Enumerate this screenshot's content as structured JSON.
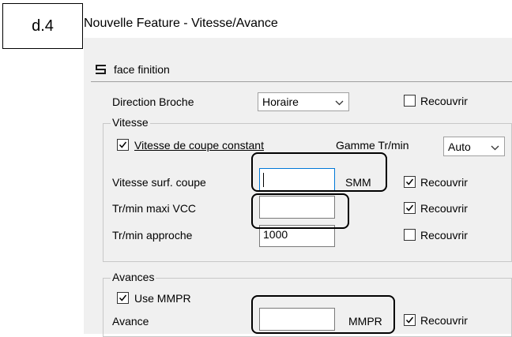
{
  "label_box": "d.4",
  "window_title": "Nouvelle Feature - Vitesse/Avance",
  "feature": {
    "icon": "layers-icon",
    "name": "face finition"
  },
  "direction": {
    "label": "Direction Broche",
    "value": "Horaire",
    "recouvrir_label": "Recouvrir",
    "recouvrir_checked": false
  },
  "vitesse": {
    "group_title": "Vitesse",
    "constant_label": "Vitesse de coupe constant",
    "constant_checked": true,
    "gamme_label": "Gamme Tr/min",
    "gamme_value": "Auto",
    "rows": [
      {
        "label": "Vitesse surf. coupe",
        "value": "",
        "unit": "SMM",
        "recouvrir_label": "Recouvrir",
        "recouvrir_checked": true
      },
      {
        "label": "Tr/min maxi VCC",
        "value": "",
        "unit": "",
        "recouvrir_label": "Recouvrir",
        "recouvrir_checked": true
      },
      {
        "label": "Tr/min approche",
        "value": "1000",
        "unit": "",
        "recouvrir_label": "Recouvrir",
        "recouvrir_checked": false
      }
    ]
  },
  "avances": {
    "group_title": "Avances",
    "use_mmpr_label": "Use MMPR",
    "use_mmpr_checked": true,
    "row": {
      "label": "Avance",
      "value": "",
      "unit": "MMPR",
      "recouvrir_label": "Recouvrir",
      "recouvrir_checked": true
    }
  }
}
